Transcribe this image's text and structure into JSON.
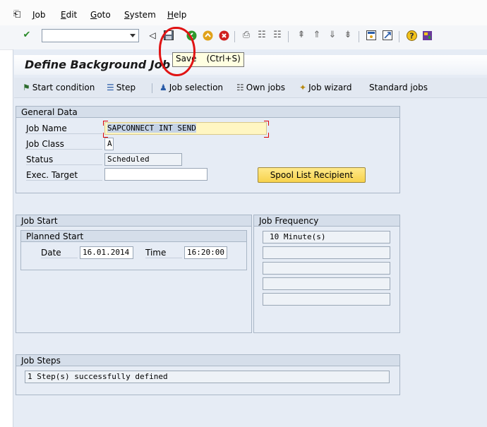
{
  "menu": {
    "items": [
      "Job",
      "Edit",
      "Goto",
      "System",
      "Help"
    ],
    "underlined": [
      "J",
      "E",
      "G",
      "S",
      "H"
    ],
    "rest": [
      "ob",
      "dit",
      "oto",
      "ystem",
      "elp"
    ]
  },
  "toolbar": {
    "command_field_value": "",
    "icons": [
      "enter-icon",
      "back-icon",
      "save-icon",
      "exit-icon",
      "cancel-icon",
      "print-icon",
      "find-icon",
      "find-next-icon",
      "first-page-icon",
      "previous-page-icon",
      "next-page-icon",
      "last-page-icon",
      "new-session-icon",
      "shortcut-icon",
      "help-icon",
      "layout-icon"
    ]
  },
  "tooltip": {
    "label": "Save",
    "shortcut": "(Ctrl+S)"
  },
  "page": {
    "title": "Define Background Job"
  },
  "appbar": {
    "start_condition": "Start condition",
    "step": "Step",
    "job_selection": "Job selection",
    "own_jobs": "Own jobs",
    "job_wizard": "Job wizard",
    "standard_jobs": "Standard jobs"
  },
  "general": {
    "title": "General Data",
    "job_name_label": "Job Name",
    "job_name_value": "SAPCONNECT INT SEND",
    "job_class_label": "Job Class",
    "job_class_value": "A",
    "status_label": "Status",
    "status_value": "Scheduled",
    "exec_target_label": "Exec. Target",
    "exec_target_value": "",
    "spool_button": "Spool List Recipient"
  },
  "job_start": {
    "title": "Job Start",
    "planned_title": "Planned Start",
    "date_label": "Date",
    "date_value": "16.01.2014",
    "time_label": "Time",
    "time_value": "16:20:00"
  },
  "frequency": {
    "title": "Job Frequency",
    "values": [
      "10 Minute(s)",
      "",
      "",
      "",
      ""
    ]
  },
  "steps": {
    "title": "Job Steps",
    "value": "1 Step(s) successfully defined"
  },
  "colors": {
    "annotation": "#e01414",
    "required_field": "#fff6c2",
    "button": "#f7d24c"
  }
}
